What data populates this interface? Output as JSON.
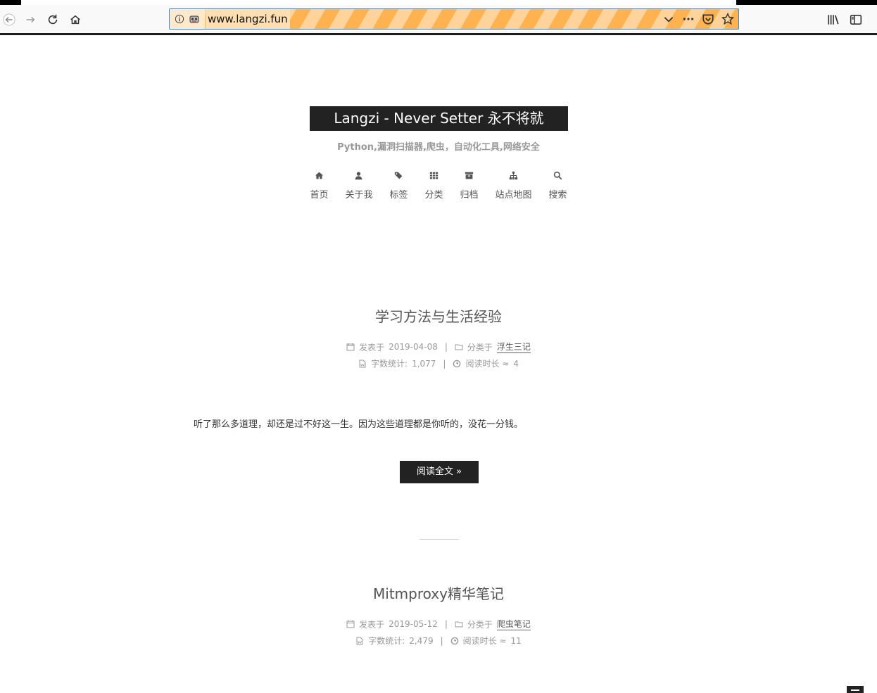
{
  "browser": {
    "url": "www.langzi.fun"
  },
  "site": {
    "title": "Langzi - Never Setter 永不将就",
    "subtitle": "Python,漏洞扫描器,爬虫，自动化工具,网络安全"
  },
  "menu": [
    {
      "label": "首页",
      "icon": "home-icon"
    },
    {
      "label": "关于我",
      "icon": "user-icon"
    },
    {
      "label": "标签",
      "icon": "tags-icon"
    },
    {
      "label": "分类",
      "icon": "th-icon"
    },
    {
      "label": "归档",
      "icon": "archive-icon"
    },
    {
      "label": "站点地图",
      "icon": "sitemap-icon"
    },
    {
      "label": "搜索",
      "icon": "search-icon"
    }
  ],
  "posts": [
    {
      "title": "学习方法与生活经验",
      "posted_label": "发表于",
      "date": "2019-04-08",
      "category_label": "分类于",
      "category": "浮生三记",
      "wordcount_label": "字数统计:",
      "wordcount": "1,077",
      "readtime_label": "阅读时长 ≈",
      "readtime": "4",
      "excerpt": "听了那么多道理，却还是过不好这一生。因为这些道理都是你听的，没花一分钱。",
      "read_more": "阅读全文 »"
    },
    {
      "title": "Mitmproxy精华笔记",
      "posted_label": "发表于",
      "date": "2019-05-12",
      "category_label": "分类于",
      "category": "爬虫笔记",
      "wordcount_label": "字数统计:",
      "wordcount": "2,479",
      "readtime_label": "阅读时长 ≈",
      "readtime": "11"
    }
  ],
  "separator": "|"
}
